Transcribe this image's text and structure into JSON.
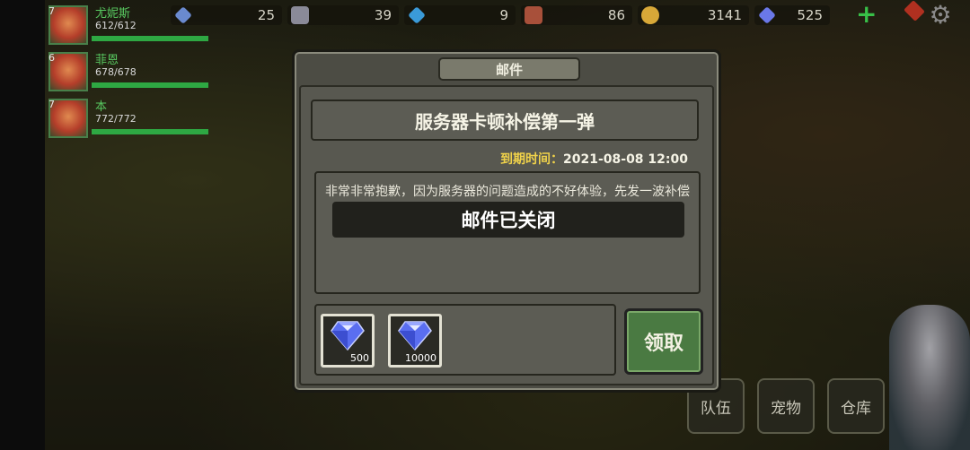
{
  "resources": [
    {
      "icon": "crystal-icon",
      "value": "25",
      "color": "#6a8acf"
    },
    {
      "icon": "ore-icon",
      "value": "39",
      "color": "#8a8a98"
    },
    {
      "icon": "blue-crystal-icon",
      "value": "9",
      "color": "#3a9ad8"
    },
    {
      "icon": "wood-icon",
      "value": "86",
      "color": "#a8503a"
    },
    {
      "icon": "gold-coin-icon",
      "value": "3141",
      "color": "#d8a838"
    },
    {
      "icon": "diamond-icon",
      "value": "525",
      "color": "#6a78e8"
    }
  ],
  "party": [
    {
      "level": "7",
      "name": "尤妮斯",
      "hp": "612/612",
      "hp_fraction": 1.0
    },
    {
      "level": "6",
      "name": "菲恩",
      "hp": "678/678",
      "hp_fraction": 1.0
    },
    {
      "level": "7",
      "name": "本",
      "hp": "772/772",
      "hp_fraction": 1.0
    }
  ],
  "bottom_menu": {
    "team": "队伍",
    "pets": "宠物",
    "storage": "仓库"
  },
  "mail": {
    "title": "邮件",
    "subject": "服务器卡顿补偿第一弹",
    "expire_label": "到期时间：",
    "expire_value": "2021-08-08 12:00",
    "body": "非常非常抱歉，因为服务器的问题造成的不好体验，先发一波补偿",
    "toast": "邮件已关闭",
    "attachments": [
      {
        "icon": "diamond-icon",
        "count": "500"
      },
      {
        "icon": "diamond-icon",
        "count": "10000"
      }
    ],
    "claim_label": "领取"
  },
  "colors": {
    "accent_green": "#4a7a42",
    "expire_gold": "#f0d24a",
    "hp_green": "#2ea843"
  }
}
